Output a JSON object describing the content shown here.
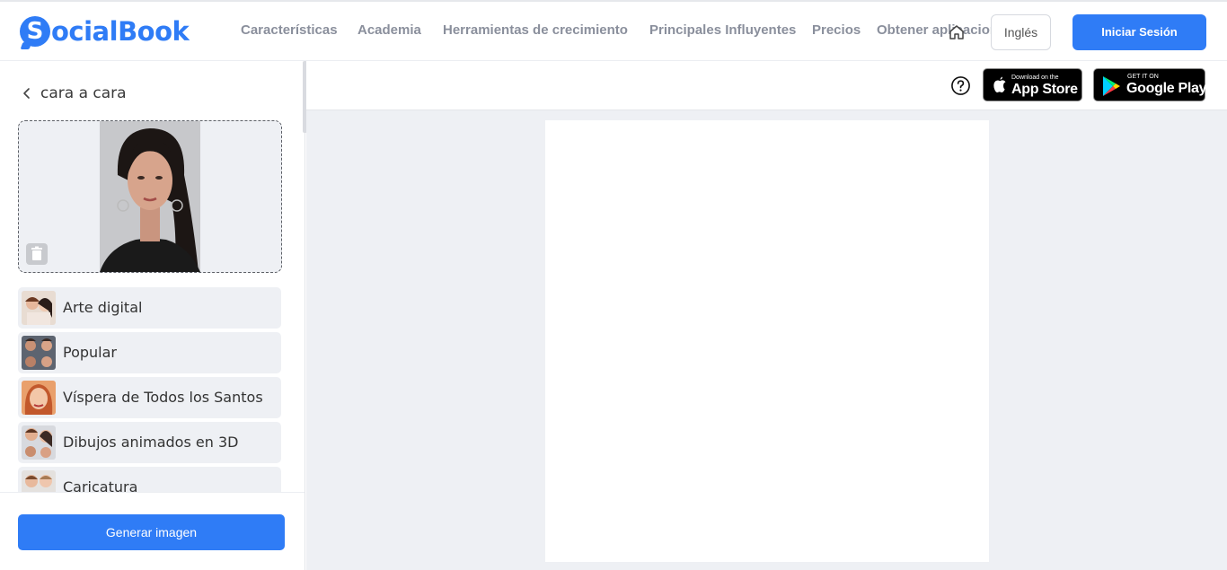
{
  "brand": {
    "logo_letter": "S",
    "logo_text": "ocialBook",
    "accent": "#2f7cf6"
  },
  "nav": {
    "items": [
      "Características",
      "Academia",
      "Herramientas de crecimiento",
      "Principales Influyentes",
      "Precios",
      "Obtener aplicaciones"
    ],
    "language_label": "Inglés",
    "login_label": "Iniciar Sesión"
  },
  "sidebar": {
    "back_label": "cara a cara",
    "styles": [
      "Arte digital",
      "Popular",
      "Víspera de Todos los Santos",
      "Dibujos animados en 3D",
      "Caricatura"
    ],
    "generate_label": "Generar imagen"
  },
  "main": {
    "app_store": {
      "small": "Download on the",
      "big": "App Store"
    },
    "google_play": {
      "small": "GET IT ON",
      "big": "Google Play"
    }
  },
  "icons": [
    "home-icon",
    "chevron-left-icon",
    "trash-icon",
    "help-icon",
    "apple-icon",
    "google-play-icon"
  ]
}
